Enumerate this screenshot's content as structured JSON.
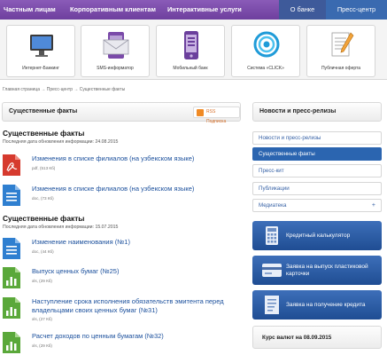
{
  "nav": {
    "private": "Частным лицам",
    "corporate": "Корпоративным клиентам",
    "interactive": "Интерактивные услуги",
    "about": "О банке",
    "press": "Пресс-центр"
  },
  "services": [
    {
      "label": "Интернет-Банкинг",
      "icon": "monitor-icon"
    },
    {
      "label": "SMS-информатор",
      "icon": "sms-envelope-icon"
    },
    {
      "label": "Мобильный банк",
      "icon": "mobile-phone-icon"
    },
    {
      "label": "Система «CLICK»",
      "icon": "click-logo-icon"
    },
    {
      "label": "Публичная оферта",
      "icon": "document-pen-icon"
    }
  ],
  "breadcrumb": "Главная страница → Пресс-центр → Существенные факты",
  "main": {
    "title": "Существенные факты",
    "rss": "RSS Подписка"
  },
  "sections": [
    {
      "title": "Существенные факты",
      "date": "Последняя дата обновления информации: 24.08.2015",
      "docs": [
        {
          "title": "Изменения в списке филиалов (на узбекском языке)",
          "meta": "pdf, (513 Кб)",
          "type": "pdf"
        },
        {
          "title": "Изменения в списке филиалов (на узбекском языке)",
          "meta": "doc, (73 Кб)",
          "type": "doc"
        }
      ]
    },
    {
      "title": "Существенные факты",
      "date": "Последняя дата обновления информации: 15.07.2015",
      "docs": [
        {
          "title": "Изменение наименования (№1)",
          "meta": "doc, (44 Кб)",
          "type": "doc"
        },
        {
          "title": "Выпуск ценных бумаг (№25)",
          "meta": "xls, (29 Кб)",
          "type": "xls"
        },
        {
          "title": "Наступление срока исполнения обязательств эмитента перед владельцами своих ценных бумаг (№31)",
          "meta": "xls, (27 Кб)",
          "type": "xls"
        },
        {
          "title": "Расчет доходов по ценным бумагам (№32)",
          "meta": "xls, (29 Кб)",
          "type": "xls"
        }
      ]
    }
  ],
  "sidebar": {
    "title": "Новости и пресс-релизы",
    "menu": [
      "Новости и пресс-релизы",
      "Существенные факты",
      "Пресс-кит",
      "Публикации",
      "Медиатека"
    ],
    "menu_plus": "+",
    "promos": [
      "Кредитный калькулятор",
      "Заявка на выпуск пластиковой карточки",
      "Заявка на получение кредита"
    ],
    "rates": "Курс валют на 08.09.2015"
  },
  "colors": {
    "nav_purple": "#7a4aa9",
    "nav_about": "#3e5a9a",
    "nav_press": "#3a6ab0",
    "link_blue": "#1a4f9c",
    "active_blue": "#2b65b0",
    "pdf_red": "#d63a2e",
    "doc_blue": "#2f7fd0",
    "xls_green": "#5aa83a"
  }
}
